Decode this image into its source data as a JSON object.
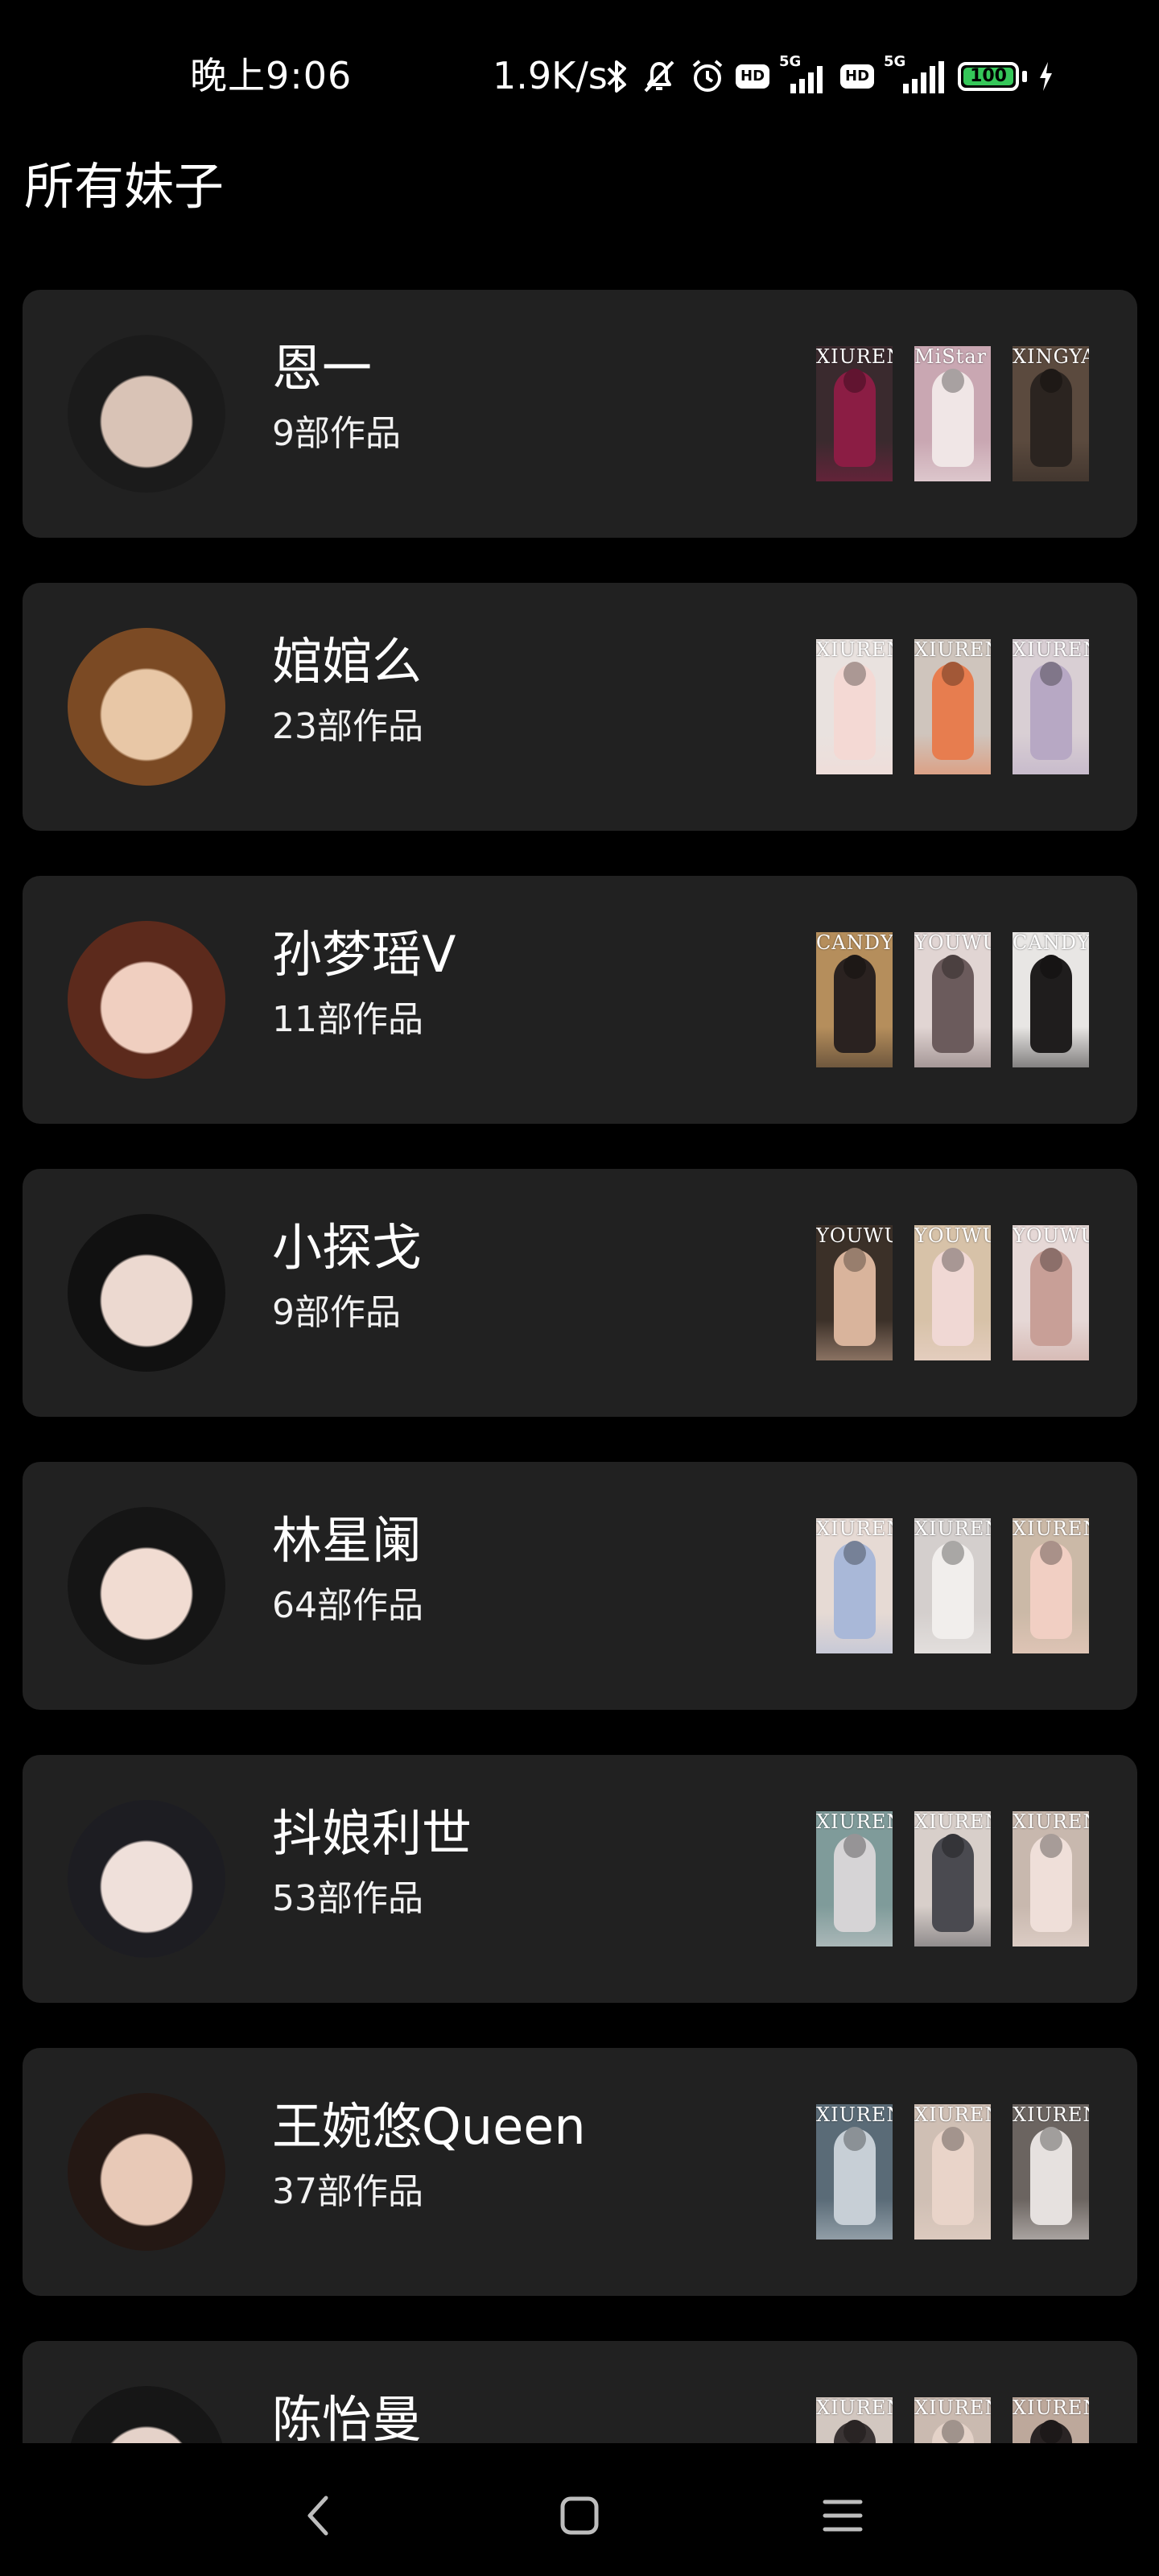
{
  "status_bar": {
    "time": "晚上9:06",
    "speed": "1.9K/s",
    "hd1": "HD",
    "net1": "5G",
    "hd2": "HD",
    "net2": "5G",
    "battery": "100",
    "battery_level": 1.0,
    "battery_color": "#35c759"
  },
  "page": {
    "title": "所有妹子"
  },
  "models": [
    {
      "name": "恩一",
      "count": "9部作品",
      "avatar_colors": [
        "#d9c3b6",
        "#1b1b1b"
      ],
      "covers": [
        {
          "brand": "XIUREN",
          "bg": "#3a2a2e",
          "figure": "#8b1d44"
        },
        {
          "brand": "MiStar",
          "bg": "#c9a7b2",
          "figure": "#f0e6e6"
        },
        {
          "brand": "XINGYAN",
          "bg": "#5b4a3e",
          "figure": "#2b2420"
        }
      ]
    },
    {
      "name": "婠婠么",
      "count": "23部作品",
      "avatar_colors": [
        "#e8c7a6",
        "#7b4a24"
      ],
      "covers": [
        {
          "brand": "XIUREN",
          "bg": "#e9e2df",
          "figure": "#f4d9d4"
        },
        {
          "brand": "XIUREN",
          "bg": "#cfc5bd",
          "figure": "#e77d4f"
        },
        {
          "brand": "XIUREN",
          "bg": "#d9cfd4",
          "figure": "#b7a8c4"
        }
      ]
    },
    {
      "name": "孙梦瑶V",
      "count": "11部作品",
      "avatar_colors": [
        "#f0cfc0",
        "#5c2a1c"
      ],
      "covers": [
        {
          "brand": "CANDY",
          "bg": "#b58e5c",
          "figure": "#2a2220"
        },
        {
          "brand": "YOUWU",
          "bg": "#e1d5d3",
          "figure": "#6b5b5c"
        },
        {
          "brand": "CANDY",
          "bg": "#e8e6e4",
          "figure": "#1f1d1d"
        }
      ]
    },
    {
      "name": "小探戈",
      "count": "9部作品",
      "avatar_colors": [
        "#ecd9d0",
        "#111111"
      ],
      "covers": [
        {
          "brand": "YOUWU",
          "bg": "#3b3028",
          "figure": "#d9b49c"
        },
        {
          "brand": "YOUWU",
          "bg": "#d7c2a8",
          "figure": "#f0d8d4"
        },
        {
          "brand": "YOUWU",
          "bg": "#e6d8d6",
          "figure": "#c89f97"
        }
      ]
    },
    {
      "name": "林星阑",
      "count": "64部作品",
      "avatar_colors": [
        "#f1dcd2",
        "#151515"
      ],
      "covers": [
        {
          "brand": "XIUREN",
          "bg": "#e6dad4",
          "figure": "#a9b8d8"
        },
        {
          "brand": "XIUREN",
          "bg": "#d4cfcd",
          "figure": "#f1eeec"
        },
        {
          "brand": "XIUREN",
          "bg": "#cbb9a7",
          "figure": "#f1cfc3"
        }
      ]
    },
    {
      "name": "抖娘利世",
      "count": "53部作品",
      "avatar_colors": [
        "#efe0da",
        "#1d1d22"
      ],
      "covers": [
        {
          "brand": "XIUREN",
          "bg": "#7f9b9a",
          "figure": "#d6d4d6"
        },
        {
          "brand": "XIUREN",
          "bg": "#d8cfca",
          "figure": "#4a4a50"
        },
        {
          "brand": "XIUREN",
          "bg": "#c8b8ae",
          "figure": "#efdfd9"
        }
      ]
    },
    {
      "name": "王婉悠Queen",
      "count": "37部作品",
      "avatar_colors": [
        "#e8c9b7",
        "#241814"
      ],
      "covers": [
        {
          "brand": "XIUREN",
          "bg": "#5a6b77",
          "figure": "#c7cfd6"
        },
        {
          "brand": "XIUREN",
          "bg": "#cfbfb4",
          "figure": "#e9d4c9"
        },
        {
          "brand": "XIUREN",
          "bg": "#6b6460",
          "figure": "#e6e1df"
        }
      ]
    },
    {
      "name": "陈怡曼",
      "count": "",
      "avatar_colors": [
        "#e5d2c9",
        "#161616"
      ],
      "covers": [
        {
          "brand": "XIUREN",
          "bg": "#d2c7c0",
          "figure": "#3a3434"
        },
        {
          "brand": "XIUREN",
          "bg": "#cabab0",
          "figure": "#e4d2c8"
        },
        {
          "brand": "XIUREN",
          "bg": "#bda89b",
          "figure": "#2a2424"
        }
      ]
    }
  ],
  "nav": {
    "back": "back-icon",
    "home": "home-icon",
    "menu": "menu-icon"
  }
}
